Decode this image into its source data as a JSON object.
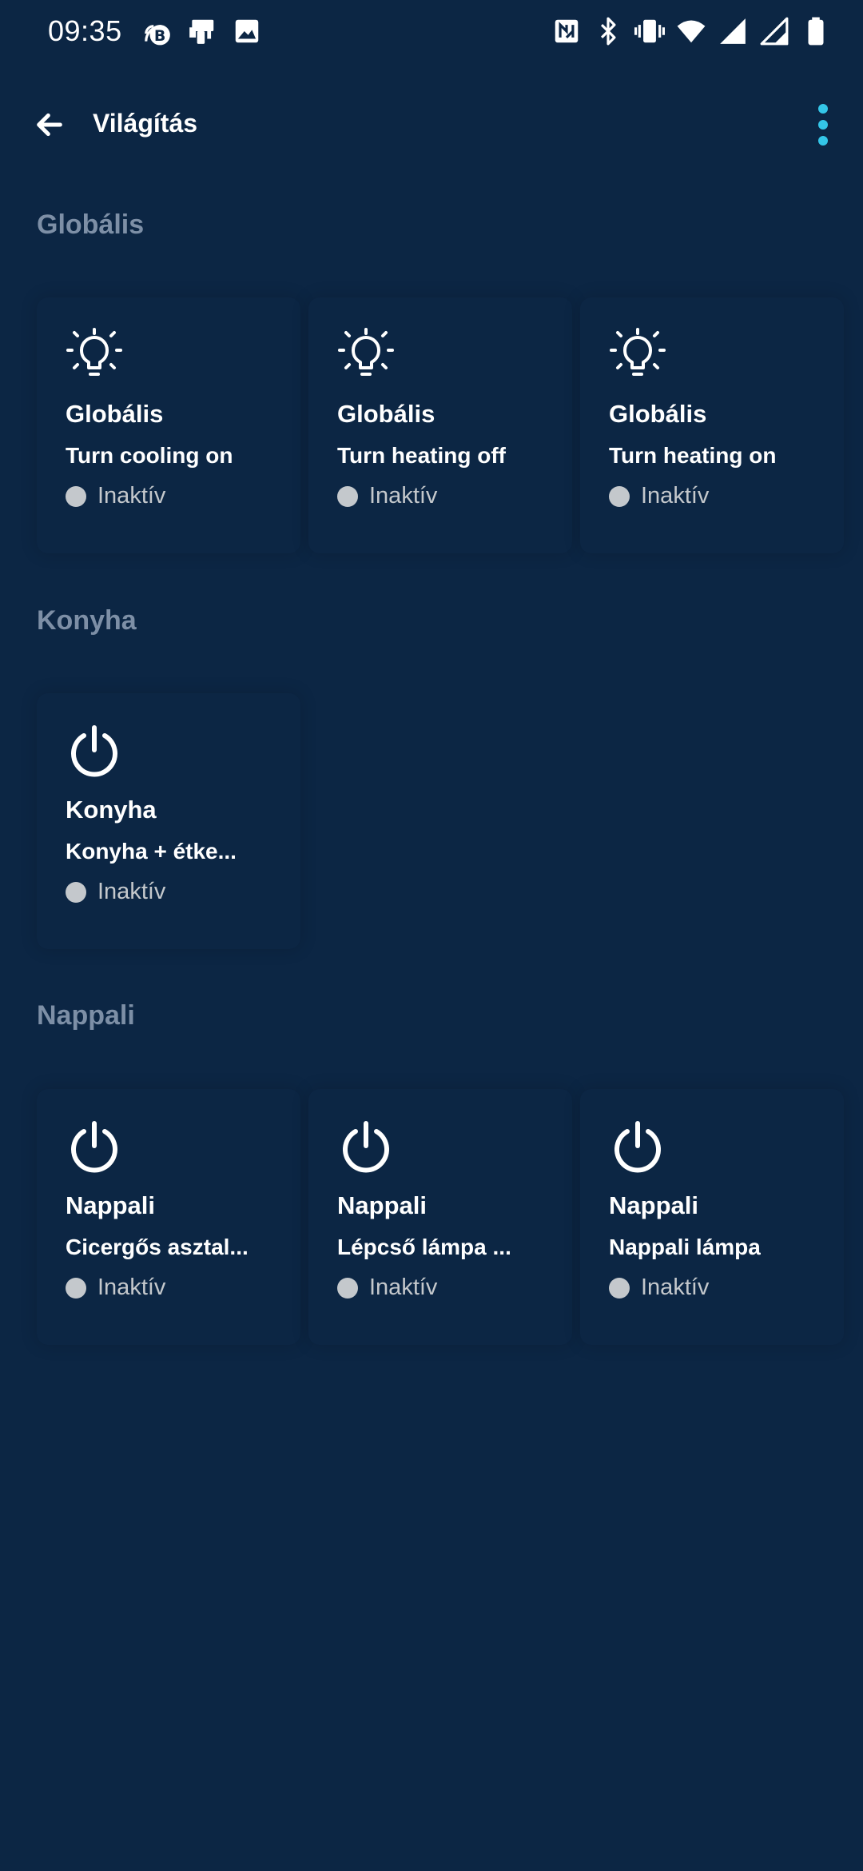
{
  "status_bar": {
    "time": "09:35",
    "left_icons": [
      "bluetooth-b-badge-icon",
      "device-icon",
      "image-icon"
    ],
    "right_icons": [
      "nfc-icon",
      "bluetooth-icon",
      "vibrate-icon",
      "wifi-icon",
      "signal-icon",
      "signal-icon",
      "battery-icon"
    ]
  },
  "app_bar": {
    "title": "Világítás",
    "back_icon": "arrow-left-icon",
    "more_icon": "more-vertical-icon",
    "accent_color": "#34c6e8"
  },
  "colors": {
    "background": "#0c2644",
    "section_header": "#7d8fa6",
    "inactive": "#c4c8cc"
  },
  "sections": [
    {
      "title": "Globális",
      "cards": [
        {
          "icon": "lightbulb-icon",
          "group": "Globális",
          "name": "Turn cooling on",
          "status": "Inaktív"
        },
        {
          "icon": "lightbulb-icon",
          "group": "Globális",
          "name": "Turn heating off",
          "status": "Inaktív"
        },
        {
          "icon": "lightbulb-icon",
          "group": "Globális",
          "name": "Turn heating on",
          "status": "Inaktív"
        }
      ]
    },
    {
      "title": "Konyha",
      "cards": [
        {
          "icon": "power-icon",
          "group": "Konyha",
          "name": "Konyha + étke...",
          "status": "Inaktív"
        }
      ]
    },
    {
      "title": "Nappali",
      "cards": [
        {
          "icon": "power-icon",
          "group": "Nappali",
          "name": "Cicergős asztal...",
          "status": "Inaktív"
        },
        {
          "icon": "power-icon",
          "group": "Nappali",
          "name": "Lépcső lámpa ...",
          "status": "Inaktív"
        },
        {
          "icon": "power-icon",
          "group": "Nappali",
          "name": "Nappali lámpa",
          "status": "Inaktív"
        }
      ]
    }
  ]
}
